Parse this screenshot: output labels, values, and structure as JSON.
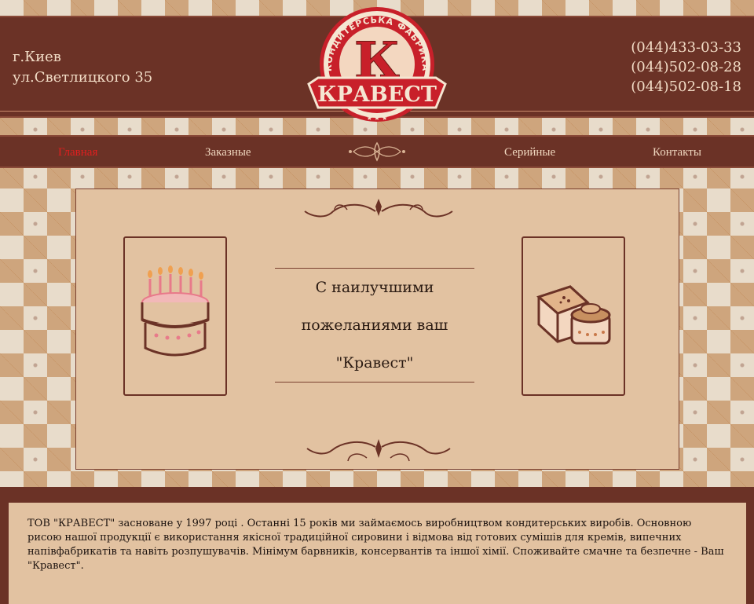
{
  "header": {
    "city": "г.Киев",
    "street": "ул.Светлицкого 35",
    "phones": [
      "(044)433-03-33",
      "(044)502-08-28",
      "(044)502-08-18"
    ]
  },
  "logo": {
    "arc_text": "КОНДИТЕРСЬКА ФАБРИКА",
    "letter": "К",
    "brand": "КРАВЕСТ",
    "colors": {
      "red": "#c8202a",
      "cream": "#f5e6d2",
      "dark": "#6b3226"
    }
  },
  "nav": {
    "items": [
      {
        "label": "Главная",
        "active": true
      },
      {
        "label": "Заказные",
        "active": false
      },
      {
        "label": "Серийные",
        "active": false
      },
      {
        "label": "Контакты",
        "active": false
      }
    ]
  },
  "main": {
    "message_lines": [
      "С наилучшими",
      "пожеланиями ваш",
      "\"Кравест\""
    ],
    "left_image": "birthday-cake-icon",
    "right_image": "pastry-cake-icon"
  },
  "footer": {
    "text": "ТОВ \"КРАВЕСТ\" засноване у 1997 році . Останні 15 років ми займаємось виробництвом кондитерських виробів. Основною рисою нашої продукції є використання якісної традиційної сировини і відмова від готових сумішів для кремів, випечних напівфабрикатів та навіть розпушувачів. Мінімум барвників, консервантів та іншої хімії. Споживайте смачне та безпечне - Ваш \"Кравест\"."
  }
}
